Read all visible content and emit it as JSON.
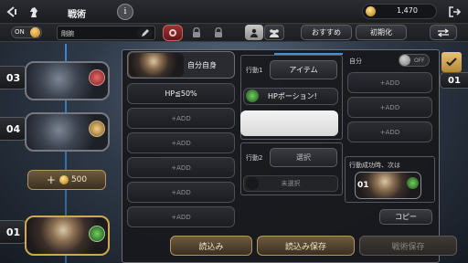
{
  "header": {
    "title": "戦術",
    "info_glyph": "i",
    "gold_amount": "1,470"
  },
  "toolbar": {
    "toggle_label": "ON",
    "tactic_name": "剛腕",
    "recommend_label": "おすすめ",
    "reset_label": "初期化"
  },
  "left_list": {
    "unit_numbers": [
      "03",
      "04",
      "01"
    ],
    "add_cost": "500",
    "add_plus": "+"
  },
  "conditions": {
    "target_label": "自分自身",
    "items": [
      "HP≦50%",
      "+ADD",
      "+ADD",
      "+ADD",
      "+ADD",
      "+ADD",
      "+ADD"
    ]
  },
  "actions": {
    "action1_label": "行動1",
    "action1_type": "アイテム",
    "action1_item": "HPポーション!",
    "action2_label": "行動2",
    "action2_select": "選択",
    "action2_unselected": "未選択"
  },
  "right_col": {
    "self_label": "自分",
    "toggle_off": "OFF",
    "adds": [
      "+ADD",
      "+ADD",
      "+ADD"
    ],
    "next_label": "行動成功時、次は",
    "next_unit": "01",
    "copy_label": "コピー"
  },
  "side": {
    "right_number": "01"
  },
  "bottom": {
    "load_label": "読込み",
    "load_save_label": "読込み保存",
    "tactic_save_label": "戦術保存"
  },
  "colors": {
    "gold": "#d8b15a",
    "accent_red": "#8c2a2a",
    "panel_border": "#6b6e74"
  }
}
